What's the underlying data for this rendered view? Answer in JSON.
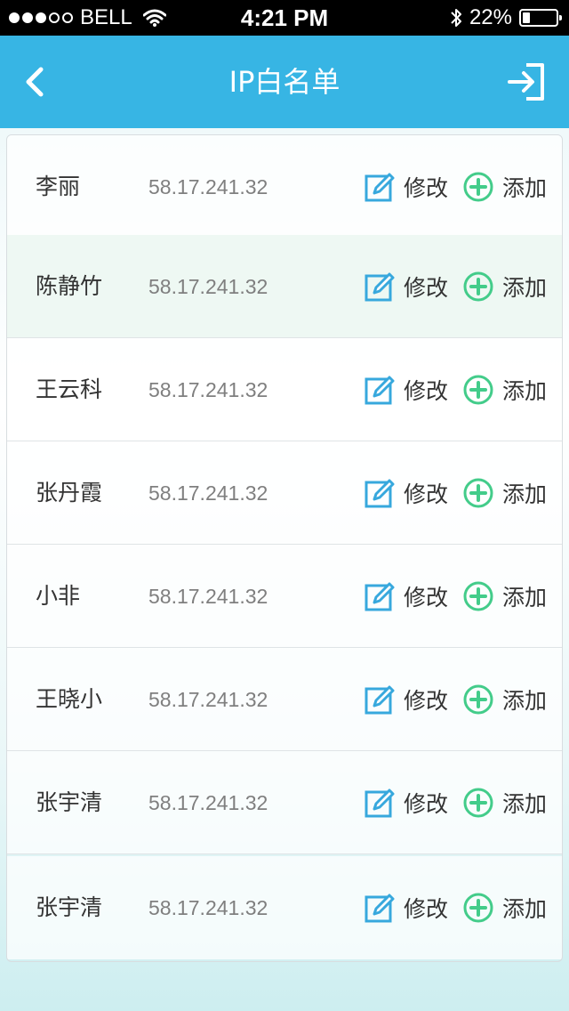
{
  "status_bar": {
    "carrier": "BELL",
    "signal_strength": 3,
    "time": "4:21 PM",
    "battery_text": "22%",
    "battery_level": 0.22
  },
  "nav": {
    "title": "IP白名单",
    "back_icon": "chevron-left-icon",
    "exit_icon": "sign-out-icon"
  },
  "colors": {
    "nav_bg": "#37b5e4",
    "edit_icon": "#37a8dd",
    "add_icon": "#43cc8a"
  },
  "rows": [
    {
      "name": "李丽",
      "ip": "58.17.241.32",
      "edit_label": "修改",
      "add_label": "添加"
    },
    {
      "name": "陈静竹",
      "ip": "58.17.241.32",
      "edit_label": "修改",
      "add_label": "添加"
    },
    {
      "name": "王云科",
      "ip": "58.17.241.32",
      "edit_label": "修改",
      "add_label": "添加"
    },
    {
      "name": "张丹霞",
      "ip": "58.17.241.32",
      "edit_label": "修改",
      "add_label": "添加"
    },
    {
      "name": "小非",
      "ip": "58.17.241.32",
      "edit_label": "修改",
      "add_label": "添加"
    },
    {
      "name": "王晓小",
      "ip": "58.17.241.32",
      "edit_label": "修改",
      "add_label": "添加"
    },
    {
      "name": "张宇清",
      "ip": "58.17.241.32",
      "edit_label": "修改",
      "add_label": "添加"
    },
    {
      "name": "张宇清",
      "ip": "58.17.241.32",
      "edit_label": "修改",
      "add_label": "添加"
    }
  ]
}
